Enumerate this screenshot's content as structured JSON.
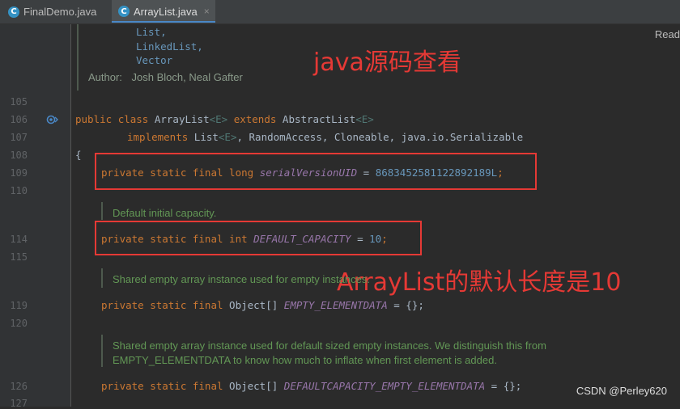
{
  "tabs": [
    {
      "label": "FinalDemo.java",
      "icon": "C"
    },
    {
      "label": "ArrayList.java",
      "icon": "C",
      "close": "×"
    }
  ],
  "reader_mode": "Read",
  "doc_top": {
    "refs": [
      "List,",
      "LinkedList,",
      "Vector"
    ],
    "author_label": "Author:",
    "author_value": "Josh Bloch, Neal Gafter"
  },
  "line_numbers": {
    "l105": "105",
    "l106": "106",
    "l107": "107",
    "l108": "108",
    "l109": "109",
    "l110": "110",
    "l114": "114",
    "l115": "115",
    "l119": "119",
    "l120": "120",
    "l126": "126",
    "l127": "127"
  },
  "code": {
    "decl_public": "public",
    "decl_class": "class",
    "decl_name": "ArrayList",
    "decl_gen1": "<E>",
    "decl_extends": "extends",
    "decl_super": "AbstractList",
    "decl_gen2": "<E>",
    "impl_kw": "implements",
    "impl_list": "List",
    "impl_gen": "<E>",
    "impl_rest": ", RandomAccess, Cloneable, java.io.Serializable",
    "brace": "{",
    "serial_mods": "private static final long",
    "serial_name": "serialVersionUID",
    "serial_eq": " = ",
    "serial_val": "8683452581122892189L",
    "semi": ";",
    "dc_mods": "private static final int",
    "dc_name": "DEFAULT_CAPACITY",
    "dc_eq": " = ",
    "dc_val": "10",
    "ee_mods": "private static final",
    "ee_type": "Object[]",
    "ee_name": "EMPTY_ELEMENTDATA",
    "ee_rest": " = {};",
    "dee_mods": "private static final",
    "dee_type": "Object[]",
    "dee_name": "DEFAULTCAPACITY_EMPTY_ELEMENTDATA",
    "dee_rest": " = {};"
  },
  "docs": {
    "default_capacity": "Default initial capacity.",
    "empty_shared": "Shared empty array instance used for empty instances.",
    "default_sized_1": "Shared empty array instance used for default sized empty instances. We distinguish this from",
    "default_sized_2": "EMPTY_ELEMENTDATA to know how much to inflate when first element is added."
  },
  "annotations": {
    "title": "java源码查看",
    "default_len": "ArrayList的默认长度是10"
  },
  "watermark": "CSDN @Perley620",
  "colors": {
    "background": "#2b2b2b",
    "keyword": "#cc7832",
    "field": "#9876aa",
    "number": "#6897bb",
    "doc": "#629755",
    "annotation_red": "#e53935"
  },
  "icons": {
    "tab_file": "java-class-icon",
    "gutter": "implemented-method-icon"
  }
}
